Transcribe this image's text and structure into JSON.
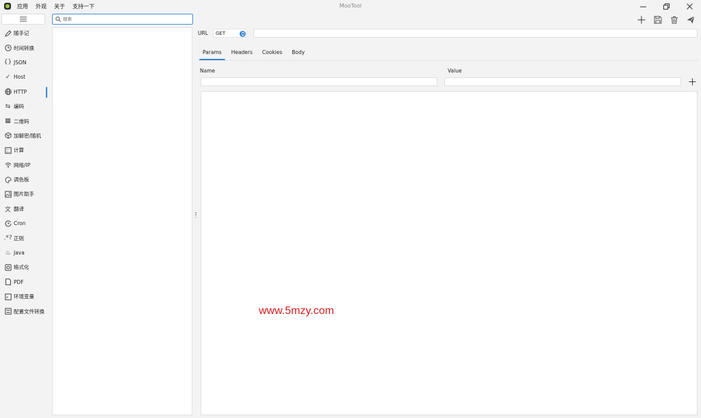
{
  "window": {
    "title": "MooTool",
    "menu": [
      "应用",
      "外观",
      "关于",
      "支持一下"
    ],
    "controls": {
      "minimize": "—",
      "restore": "❐",
      "close": "✕"
    }
  },
  "sidebar": {
    "items": [
      {
        "label": "随手记",
        "icon": "pen-icon"
      },
      {
        "label": "时间转换",
        "icon": "clock-icon"
      },
      {
        "label": "JSON",
        "icon": "braces-icon"
      },
      {
        "label": "Host",
        "icon": "check-icon"
      },
      {
        "label": "HTTP",
        "icon": "globe-icon",
        "active": true
      },
      {
        "label": "编码",
        "icon": "arrows-icon"
      },
      {
        "label": "二维码",
        "icon": "qrcode-icon"
      },
      {
        "label": "加解密/随机",
        "icon": "cube-icon"
      },
      {
        "label": "计算",
        "icon": "calculator-icon"
      },
      {
        "label": "网络/IP",
        "icon": "wifi-icon"
      },
      {
        "label": "调色板",
        "icon": "palette-icon"
      },
      {
        "label": "图片助手",
        "icon": "image-icon"
      },
      {
        "label": "翻译",
        "icon": "translate-icon"
      },
      {
        "label": "Cron",
        "icon": "cron-clock-icon"
      },
      {
        "label": "正则",
        "icon": "regex-icon"
      },
      {
        "label": "Java",
        "icon": "java-icon"
      },
      {
        "label": "格式化",
        "icon": "format-icon"
      },
      {
        "label": "PDF",
        "icon": "pdf-icon"
      },
      {
        "label": "环境变量",
        "icon": "env-icon"
      },
      {
        "label": "配置文件转换",
        "icon": "config-icon"
      }
    ]
  },
  "search": {
    "placeholder": "搜索"
  },
  "request": {
    "url_label": "URL",
    "method": "GET",
    "url_value": ""
  },
  "tabs": [
    {
      "label": "Params",
      "active": true
    },
    {
      "label": "Headers"
    },
    {
      "label": "Cookies"
    },
    {
      "label": "Body"
    }
  ],
  "params": {
    "name_header": "Name",
    "value_header": "Value"
  },
  "watermark": "www.5mzy.com",
  "colors": {
    "accent": "#3a84d6",
    "watermark": "#d42020"
  }
}
